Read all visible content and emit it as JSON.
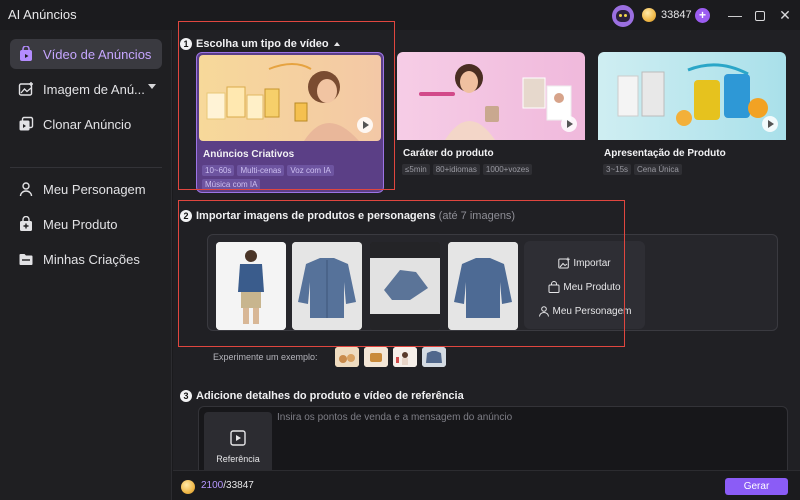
{
  "app": {
    "title": "AI Anúncios"
  },
  "account": {
    "credits": "33847",
    "plus_label": "+"
  },
  "window_controls": {
    "minimize": "—",
    "close": "✕"
  },
  "sidebar": {
    "items": [
      {
        "label": "Vídeo de Anúncios",
        "icon": "video-bag-icon",
        "active": true
      },
      {
        "label": "Imagem de Anú...",
        "icon": "image-add-icon",
        "has_dropdown": true
      },
      {
        "label": "Clonar Anúncio",
        "icon": "clone-icon"
      },
      {
        "label": "Meu Personagem",
        "icon": "person-icon"
      },
      {
        "label": "Meu Produto",
        "icon": "product-bag-icon"
      },
      {
        "label": "Minhas Criações",
        "icon": "folder-icon"
      }
    ]
  },
  "step1": {
    "number": "1",
    "title": "Escolha um tipo de vídeo",
    "cards": [
      {
        "title": "Anúncios Criativos",
        "tags": [
          "10~60s",
          "Multi-cenas",
          "Voz com IA",
          "Música com IA"
        ],
        "selected": true
      },
      {
        "title": "Caráter do produto",
        "tags": [
          "≤5min",
          "80+idiomas",
          "1000+vozes"
        ]
      },
      {
        "title": "Apresentação de Produto",
        "tags": [
          "3~15s",
          "Cena Única"
        ]
      }
    ]
  },
  "step2": {
    "number": "2",
    "title": "Importar imagens de produtos e personagens",
    "subtitle": "(até 7 imagens)",
    "actions": {
      "import": "Importar",
      "product": "Meu Produto",
      "character": "Meu Personagem"
    },
    "examples_label": "Experimente um exemplo:"
  },
  "step3": {
    "number": "3",
    "title": "Adicione detalhes do produto e vídeo de referência",
    "placeholder": "Insira os pontos de venda e a mensagem do anúncio",
    "reference_label": "Referência"
  },
  "footer": {
    "used": "2100",
    "total": "/33847",
    "generate_label": "Gerar"
  },
  "colors": {
    "accent": "#8b5cf6",
    "selected_card": "#5b3f86",
    "annotation": "#e0463f"
  }
}
